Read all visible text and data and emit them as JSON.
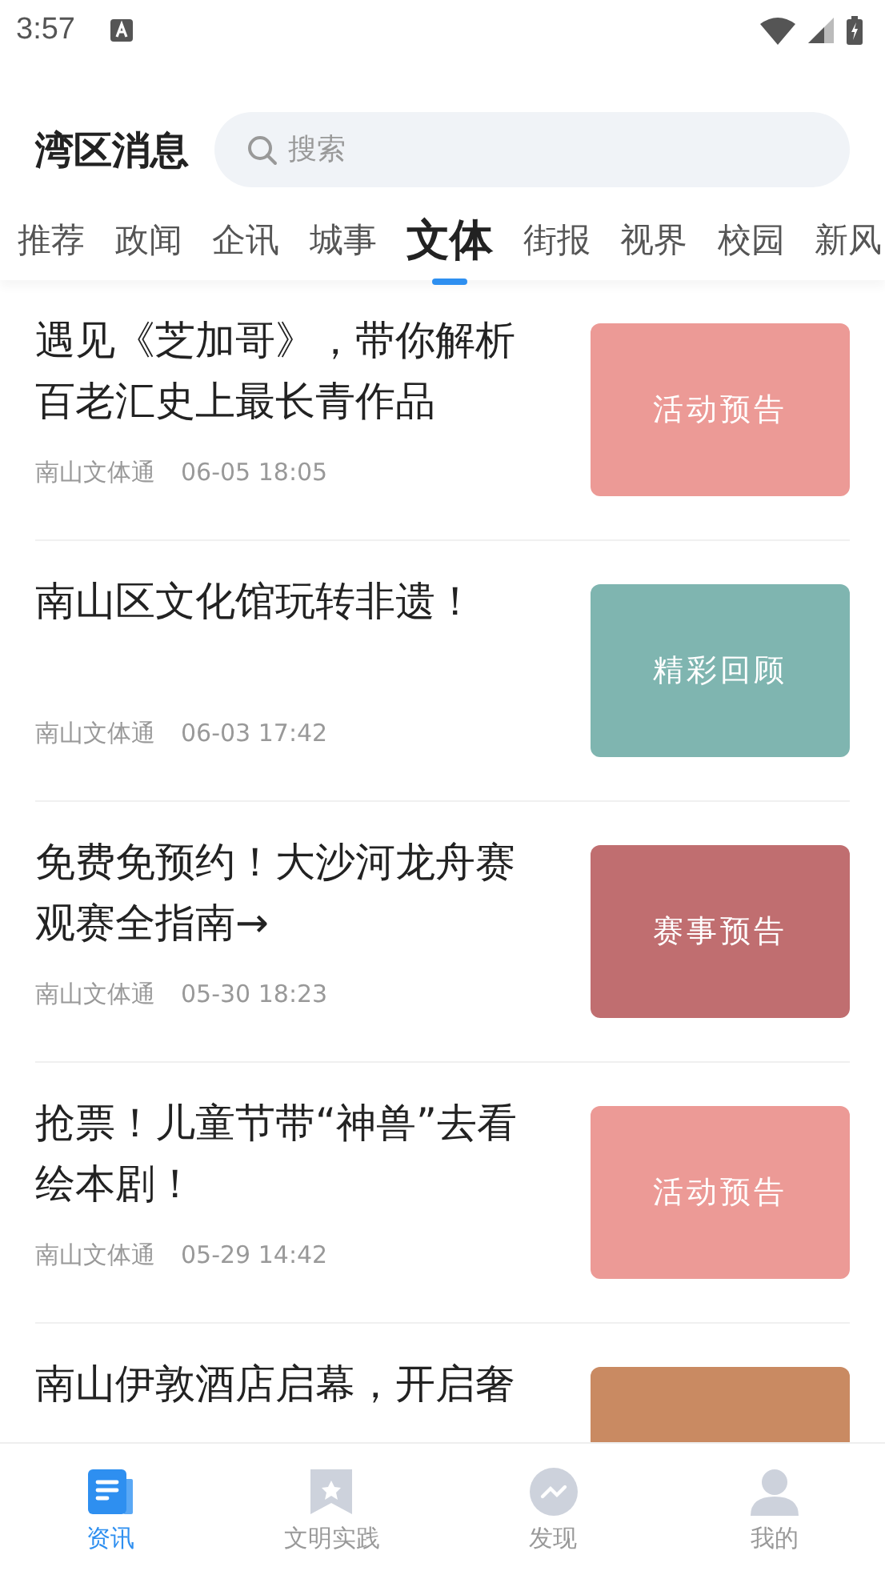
{
  "status_bar": {
    "time": "3:57"
  },
  "header": {
    "title": "湾区消息",
    "search": {
      "placeholder": "搜索"
    }
  },
  "tabs": [
    {
      "label": "推荐",
      "selected": false
    },
    {
      "label": "政闻",
      "selected": false
    },
    {
      "label": "企讯",
      "selected": false
    },
    {
      "label": "城事",
      "selected": false
    },
    {
      "label": "文体",
      "selected": true
    },
    {
      "label": "街报",
      "selected": false
    },
    {
      "label": "视界",
      "selected": false
    },
    {
      "label": "校园",
      "selected": false
    },
    {
      "label": "新风",
      "selected": false
    }
  ],
  "articles": [
    {
      "title": "遇见《芝加哥》，带你解析百老汇史上最长青作品",
      "source": "南山文体通",
      "time": "06-05 18:05",
      "thumb": {
        "text": "活动预告",
        "color": "#ec9a96"
      }
    },
    {
      "title": "南山区文化馆玩转非遗！",
      "source": "南山文体通",
      "time": "06-03 17:42",
      "thumb": {
        "text": "精彩回顾",
        "color": "#7fb5b0"
      }
    },
    {
      "title": "免费免预约！大沙河龙舟赛观赛全指南→",
      "source": "南山文体通",
      "time": "05-30 18:23",
      "thumb": {
        "text": "赛事预告",
        "color": "#c06e70"
      }
    },
    {
      "title": "抢票！儿童节带“神兽”去看绘本剧！",
      "source": "南山文体通",
      "time": "05-29 14:42",
      "thumb": {
        "text": "活动预告",
        "color": "#ec9a96"
      }
    },
    {
      "title": "南山伊敦酒店启幕，开启奢",
      "thumb": {
        "color": "#c98a62"
      }
    }
  ],
  "bottom_nav": [
    {
      "label": "资讯",
      "selected": true
    },
    {
      "label": "文明实践",
      "selected": false
    },
    {
      "label": "发现",
      "selected": false
    },
    {
      "label": "我的",
      "selected": false
    }
  ]
}
